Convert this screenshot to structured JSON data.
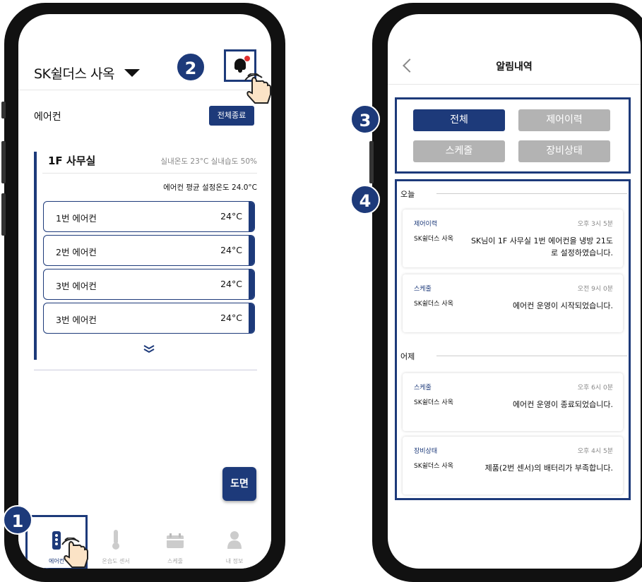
{
  "left": {
    "site_title": "SK쉴더스 사옥",
    "section_title": "에어컨",
    "stop_all_label": "전체종료",
    "room": {
      "name": "1F 사무실",
      "env": "실내온도 23°C 실내습도 50%",
      "avg_setpoint": "에어컨 평균 설정온도 24.0°C",
      "units": [
        {
          "name": "1번 에어컨",
          "temp": "24°C"
        },
        {
          "name": "2번 에어컨",
          "temp": "24°C"
        },
        {
          "name": "3번 에어컨",
          "temp": "24°C"
        },
        {
          "name": "3번 에어컨",
          "temp": "24°C"
        }
      ]
    },
    "map_button": "도면",
    "tabs": [
      {
        "label": "에어컨",
        "icon": "aircon-remote-icon"
      },
      {
        "label": "온습도 센서",
        "icon": "thermometer-icon"
      },
      {
        "label": "스케줄",
        "icon": "calendar-icon"
      },
      {
        "label": "내 정보",
        "icon": "person-icon"
      }
    ]
  },
  "right": {
    "title": "알림내역",
    "filters": [
      "전체",
      "제어이력",
      "스케줄",
      "장비상태"
    ],
    "active_filter": "전체",
    "groups": [
      {
        "day": "오늘",
        "items": [
          {
            "category": "제어이력",
            "time": "오후 3시 5분",
            "source": "SK쉴더스 사옥",
            "message": "SK님이 1F 사무실 1번 에어컨을 냉방 21도로 설정하였습니다."
          },
          {
            "category": "스케줄",
            "time": "오전 9시 0분",
            "source": "SK쉴더스 사옥",
            "message": "에어컨 운영이 시작되었습니다."
          }
        ]
      },
      {
        "day": "어제",
        "items": [
          {
            "category": "스케줄",
            "time": "오후 6시 0분",
            "source": "SK쉴더스 사옥",
            "message": "에어컨 운영이 종료되었습니다."
          },
          {
            "category": "장비상태",
            "time": "오후 4시 5분",
            "source": "SK쉴더스 사옥",
            "message": "제품(2번 센서)의 배터리가 부족합니다."
          }
        ]
      }
    ]
  },
  "steps": [
    "1",
    "2",
    "3",
    "4"
  ],
  "colors": {
    "brand": "#1d3a7a",
    "inactive": "#b3b3b3",
    "alert_dot": "#e03030"
  }
}
